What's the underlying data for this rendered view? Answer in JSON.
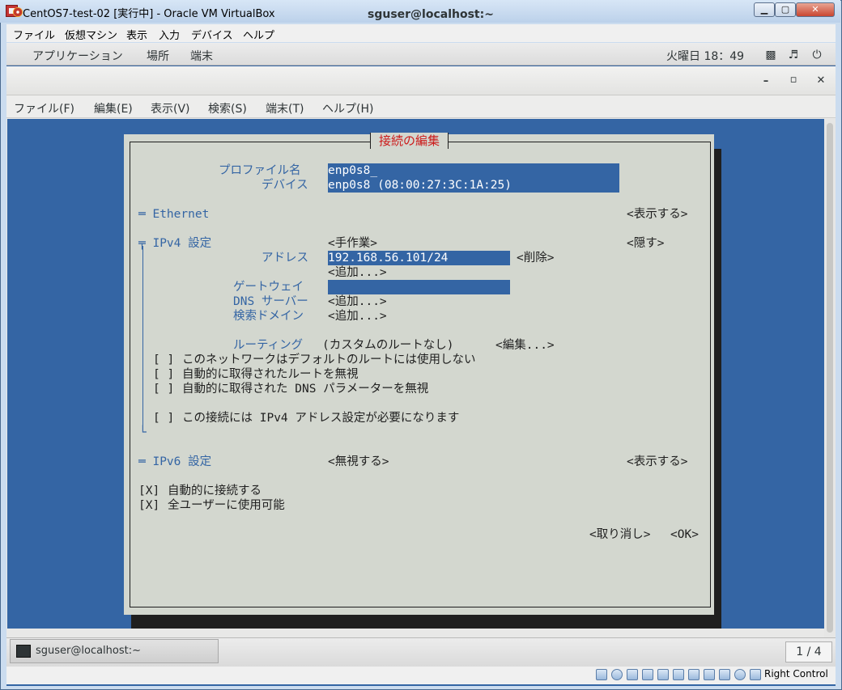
{
  "vbox": {
    "title": "CentOS7-test-02 [実行中] - Oracle VM VirtualBox",
    "controls": {
      "minimize": "▁",
      "maximize": "▢",
      "close": "✕"
    },
    "menu": [
      "ファイル",
      "仮想マシン",
      "表示",
      "入力",
      "デバイス",
      "ヘルプ"
    ],
    "host_key": "Right Control"
  },
  "gnome": {
    "menus": [
      "アプリケーション",
      "場所",
      "端末"
    ],
    "clock": "火曜日 18：49",
    "tray_icons": [
      "network-icon",
      "volume-icon",
      "power-icon"
    ]
  },
  "terminal": {
    "title": "sguser@localhost:~",
    "controls": {
      "minimize": "–",
      "maximize": "▫",
      "close": "✕"
    },
    "menu": [
      "ファイル(F)",
      "編集(E)",
      "表示(V)",
      "検索(S)",
      "端末(T)",
      "ヘルプ(H)"
    ]
  },
  "dialog": {
    "title": "接続の編集",
    "profile_label": "プロファイル名",
    "profile_value": "enp0s8_",
    "device_label": "デバイス",
    "device_value": "enp0s8 (08:00:27:3C:1A:25)",
    "ethernet_label": "═ Ethernet",
    "ethernet_action": "<表示する>",
    "ipv4_label": "╤ IPv4 設定",
    "ipv4_mode": "<手作業>",
    "ipv4_action": "<隠す>",
    "address_label": "アドレス",
    "address_value": "192.168.56.101/24",
    "address_remove": "<削除>",
    "address_add": "<追加...>",
    "gateway_label": "ゲートウェイ",
    "gateway_value": "",
    "dns_label": "DNS サーバー",
    "dns_add": "<追加...>",
    "search_label": "検索ドメイン",
    "search_add": "<追加...>",
    "routing_label": "ルーティング",
    "routing_value": "(カスタムのルートなし)",
    "routing_edit": "<編集...>",
    "checkboxes": [
      {
        "mark": "[ ]",
        "label": "このネットワークはデフォルトのルートには使用しない"
      },
      {
        "mark": "[ ]",
        "label": "自動的に取得されたルートを無視"
      },
      {
        "mark": "[ ]",
        "label": "自動的に取得された DNS パラメーターを無視"
      },
      {
        "mark": "[ ]",
        "label": "この接続には IPv4 アドレス設定が必要になります"
      }
    ],
    "ipv4_end": "└",
    "ipv6_label": "═ IPv6 設定",
    "ipv6_mode": "<無視する>",
    "ipv6_action": "<表示する>",
    "auto_connect": {
      "mark": "[X]",
      "label": "自動的に接続する"
    },
    "all_users": {
      "mark": "[X]",
      "label": "全ユーザーに使用可能"
    },
    "cancel": "<取り消し>",
    "ok": "<OK>"
  },
  "taskbar": {
    "task_label": "sguser@localhost:~",
    "workspace": "1 / 4"
  }
}
